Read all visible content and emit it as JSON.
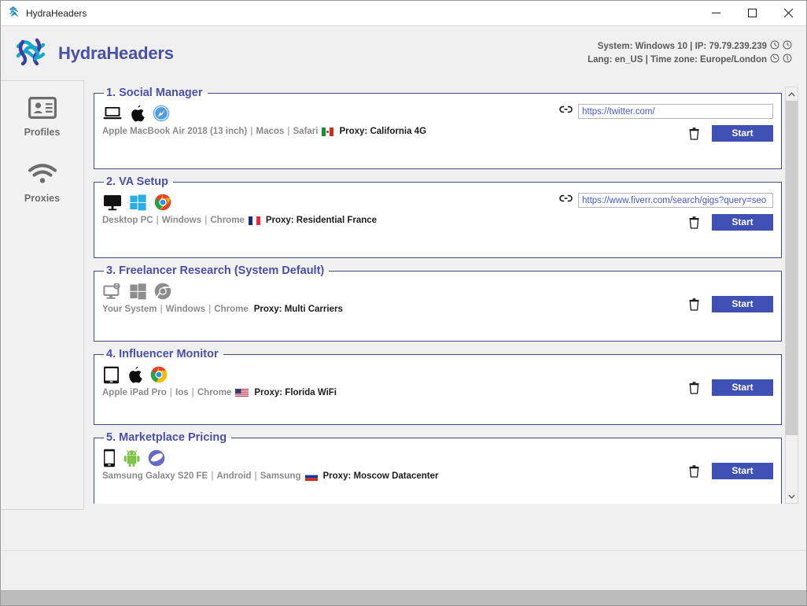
{
  "window": {
    "title": "HydraHeaders",
    "app_icon": "hydra-knot-icon",
    "minimize_label": "Minimize",
    "maximize_label": "Maximize",
    "close_label": "Close"
  },
  "header": {
    "brand": "HydraHeaders",
    "logo_icon": "hydra-knot-logo",
    "brand_color": "#4a4fa8",
    "sysinfo_line1": "System: Windows 10 | IP: 79.79.239.239",
    "sysinfo_line2": "Lang: en_US | Time zone: Europe/London",
    "clock_icon_1": "clock-icon",
    "clock_icon_2": "clock-icon"
  },
  "sidebar": {
    "items": [
      {
        "label": "Profiles",
        "icon": "id-card-icon"
      },
      {
        "label": "Proxies",
        "icon": "wifi-icon"
      }
    ]
  },
  "profiles": [
    {
      "title": "1. Social Manager",
      "device_icon": "laptop-icon",
      "os_icon": "apple-icon",
      "browser_icon": "safari-icon",
      "device": "Apple MacBook Air 2018 (13 inch)",
      "os": "Macos",
      "browser": "Safari",
      "flag_icon": "flag-mexico",
      "proxy": "Proxy: California 4G",
      "url": "https://twitter.com/",
      "url_placeholder": "https://",
      "link_icon": "link-icon",
      "delete_icon": "trash-icon",
      "start_label": "Start",
      "has_url": true,
      "disabled": false
    },
    {
      "title": "2. VA Setup",
      "device_icon": "desktop-icon",
      "os_icon": "windows-icon",
      "browser_icon": "chrome-icon",
      "device": "Desktop PC",
      "os": "Windows",
      "browser": "Chrome",
      "flag_icon": "flag-france",
      "proxy": "Proxy: Residential France",
      "url": "https://www.fiverr.com/search/gigs?query=seo",
      "url_placeholder": "https://",
      "link_icon": "link-icon",
      "delete_icon": "trash-icon",
      "start_label": "Start",
      "has_url": true,
      "disabled": false
    },
    {
      "title": "3. Freelancer Research (System Default)",
      "device_icon": "system-monitor-icon",
      "os_icon": "windows-icon",
      "browser_icon": "chrome-icon",
      "device": "Your System",
      "os": "Windows",
      "browser": "Chrome",
      "flag_icon": "",
      "proxy": "Proxy: Multi Carriers",
      "url": "",
      "url_placeholder": "",
      "link_icon": "",
      "delete_icon": "trash-icon",
      "start_label": "Start",
      "has_url": false,
      "disabled": true
    },
    {
      "title": "4. Influencer Monitor",
      "device_icon": "tablet-icon",
      "os_icon": "apple-icon",
      "browser_icon": "chrome-icon",
      "device": "Apple iPad Pro",
      "os": "Ios",
      "browser": "Chrome",
      "flag_icon": "flag-usa",
      "proxy": "Proxy: Florida WiFi",
      "url": "",
      "url_placeholder": "",
      "link_icon": "",
      "delete_icon": "trash-icon",
      "start_label": "Start",
      "has_url": false,
      "disabled": false
    },
    {
      "title": "5. Marketplace Pricing",
      "device_icon": "phone-icon",
      "os_icon": "android-icon",
      "browser_icon": "samsung-internet-icon",
      "device": "Samsung Galaxy S20 FE",
      "os": "Android",
      "browser": "Samsung",
      "flag_icon": "flag-russia",
      "proxy": "Proxy: Moscow Datacenter",
      "url": "",
      "url_placeholder": "",
      "link_icon": "",
      "delete_icon": "trash-icon",
      "start_label": "Start",
      "has_url": false,
      "disabled": false
    }
  ],
  "scrollbar": {
    "up_icon": "chevron-up-icon",
    "down_icon": "chevron-down-icon"
  },
  "separator": "|",
  "colors": {
    "accent": "#3f51b5",
    "card_border": "#3f4d7a",
    "title_text": "#4a4fa8",
    "meta_text": "#8b8b8b"
  }
}
